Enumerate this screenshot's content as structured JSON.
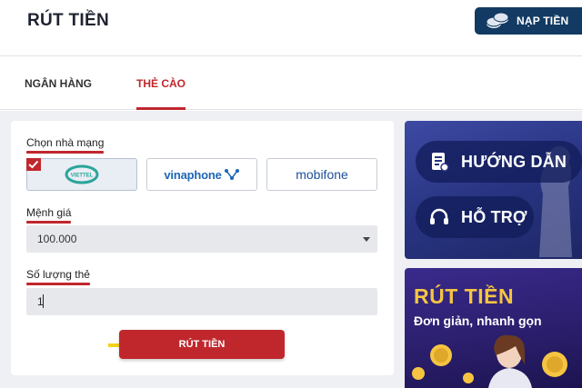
{
  "header": {
    "title": "RÚT TIỀN",
    "topup_label": "NẠP TIỀN"
  },
  "tabs": [
    {
      "label": "NGÂN HÀNG",
      "active": false
    },
    {
      "label": "THẺ CÀO",
      "active": true
    }
  ],
  "form": {
    "operator_label": "Chọn nhà mạng",
    "operators": [
      {
        "name": "VIETTEL",
        "selected": true
      },
      {
        "name": "vinaphone",
        "selected": false
      },
      {
        "name": "mobifone",
        "selected": false
      }
    ],
    "denomination_label": "Mệnh giá",
    "denomination_value": "100.000",
    "quantity_label": "Số lượng thẻ",
    "quantity_value": "1",
    "submit_label": "RÚT TIỀN"
  },
  "side": {
    "guide_label": "HƯỚNG DẪN",
    "support_label": "HỖ TRỢ",
    "promo_title": "RÚT TIỀN",
    "promo_subtitle": "Đơn giản, nhanh gọn"
  },
  "colors": {
    "accent": "#c0272d",
    "topup_bg": "#123a63",
    "promo_gold": "#f5c542"
  },
  "icons": [
    "coins-icon",
    "check-icon",
    "document-icon",
    "headset-icon",
    "pointer-arrow-icon"
  ]
}
